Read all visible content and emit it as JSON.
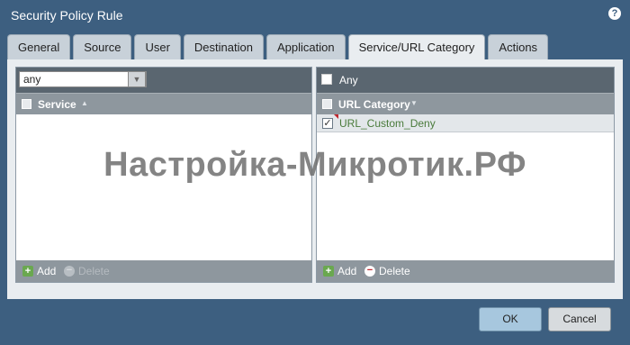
{
  "dialog": {
    "title": "Security Policy Rule",
    "help_icon": "help-icon"
  },
  "tabs": [
    {
      "label": "General"
    },
    {
      "label": "Source"
    },
    {
      "label": "User"
    },
    {
      "label": "Destination"
    },
    {
      "label": "Application"
    },
    {
      "label": "Service/URL Category",
      "active": true
    },
    {
      "label": "Actions"
    }
  ],
  "service_panel": {
    "select_value": "any",
    "column_header": "Service",
    "add_label": "Add",
    "delete_label": "Delete"
  },
  "url_panel": {
    "any_label": "Any",
    "any_checked": false,
    "column_header": "URL Category",
    "rows": [
      {
        "label": "URL_Custom_Deny",
        "checked": true
      }
    ],
    "add_label": "Add",
    "delete_label": "Delete"
  },
  "watermark": "Настройка-Микротик.РФ",
  "buttons": {
    "ok": "OK",
    "cancel": "Cancel"
  },
  "colors": {
    "dialog_bg": "#3d5f80",
    "active_tab": "#e9edf0",
    "row_text": "#4a7b3b"
  }
}
